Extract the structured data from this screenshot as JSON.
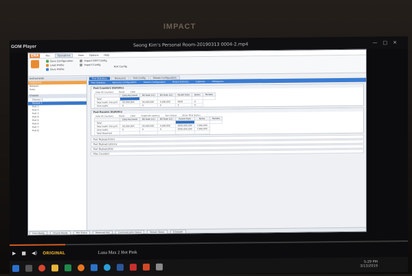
{
  "wall_sign": "IMPACT",
  "player": {
    "logo": "GOM Player",
    "title": "Seong Kim's Personal Room-20190313 0004-2.mp4",
    "controls": [
      "—",
      "□",
      "✕"
    ]
  },
  "app": {
    "logo": "ENA",
    "tabs": [
      "File",
      "Operations",
      "View",
      "Options",
      "Help"
    ],
    "active_tab": "Operations",
    "ribbon": {
      "group1": [
        "Save Configuration",
        "Load Profile",
        "Save Profile"
      ],
      "group2": [
        "Import DIST Config",
        "Import Config"
      ],
      "big_button_label": "Port Config"
    },
    "left_pane": {
      "header": "Instruments",
      "rows": [
        "Instrument",
        "Network",
        "Ports"
      ],
      "tree_header": "Chassis",
      "tree_items": [
        "Chassis 1",
        "Module 1",
        "Port 1",
        "Port 2",
        "Port 3",
        "Port 4",
        "Port 5",
        "Port 6",
        "Port 7",
        "Port 8"
      ]
    },
    "main_tabs": [
      "Port Statistics",
      "Resources",
      "Port Config",
      "Stream Configuration"
    ],
    "active_main_tab": "Port Statistics",
    "toolbar_items": [
      "Port Statistics",
      "Resource Configuration",
      "Stream Configuration",
      "Global Statistics",
      "Captures",
      "Histograms"
    ],
    "section1": {
      "title": "Port Counters Statistics",
      "bar_items": [
        "View All Counters",
        "Reset",
        "Clear"
      ],
      "columns": [
        "Data Received",
        "Bit Rate (L1)",
        "Bit Rate (L2)",
        "Packet Rate",
        "Bytes",
        "Packets"
      ],
      "rows": [
        [
          "Total",
          "",
          "",
          "",
          "",
          ""
        ],
        [
          "Total traffic this port",
          "00,000,000",
          "00,000,000",
          "0,000,000",
          "0000",
          "0"
        ],
        [
          "Sent traffic",
          "0",
          "0",
          "0",
          "0",
          "0"
        ]
      ]
    },
    "section2": {
      "title": "Port Receive Statistics",
      "bar_items": [
        "View All Counters",
        "Reset",
        "Clear",
        "Duplicate Latency",
        "Sort Status",
        "Show Total Status"
      ],
      "columns": [
        "Data Received",
        "Bit Rate (L1)",
        "Bit Rate (L2)",
        "Packet Rate",
        "Bytes",
        "Packets"
      ],
      "rows": [
        [
          "Total",
          "",
          "",
          "",
          "",
          ""
        ],
        [
          "Total traffic this port",
          "00,000,000",
          "00,000,000",
          "0,000,000",
          "0000,000,000",
          "7,000,000"
        ],
        [
          "Sent traffic",
          "0",
          "0",
          "0",
          "0000,000,000",
          "7,000,000"
        ],
        [
          "Total Received",
          "",
          "",
          "",
          "",
          ""
        ]
      ]
    },
    "empty_sections": [
      "Port Payload Errors",
      "Port Payload Latency",
      "Port Payload Jitter",
      "Misc Counters"
    ],
    "status_items": [
      "Conn Ready",
      "Chassis Ready",
      "Port Status",
      "Reserved Port",
      "Communication Status",
      "Stream Status",
      "Scheduler"
    ]
  },
  "playback": {
    "progress": 0.14,
    "now_playing": "Luna Max 2 Hot Pink",
    "brand": "ORIGINAL"
  },
  "taskbar": {
    "icons": [
      "windows-icon",
      "search-icon",
      "chrome-icon",
      "folder-icon",
      "excel-icon",
      "firefox-icon",
      "outlook-icon",
      "skype-icon",
      "word-icon",
      "pdf-icon",
      "powerpoint-icon",
      "media-icon"
    ],
    "clock_time": "5:29 PM",
    "clock_date": "3/13/2019"
  },
  "colors": {
    "accent_orange": "#e0863c",
    "accent_blue": "#2f6fc2"
  }
}
